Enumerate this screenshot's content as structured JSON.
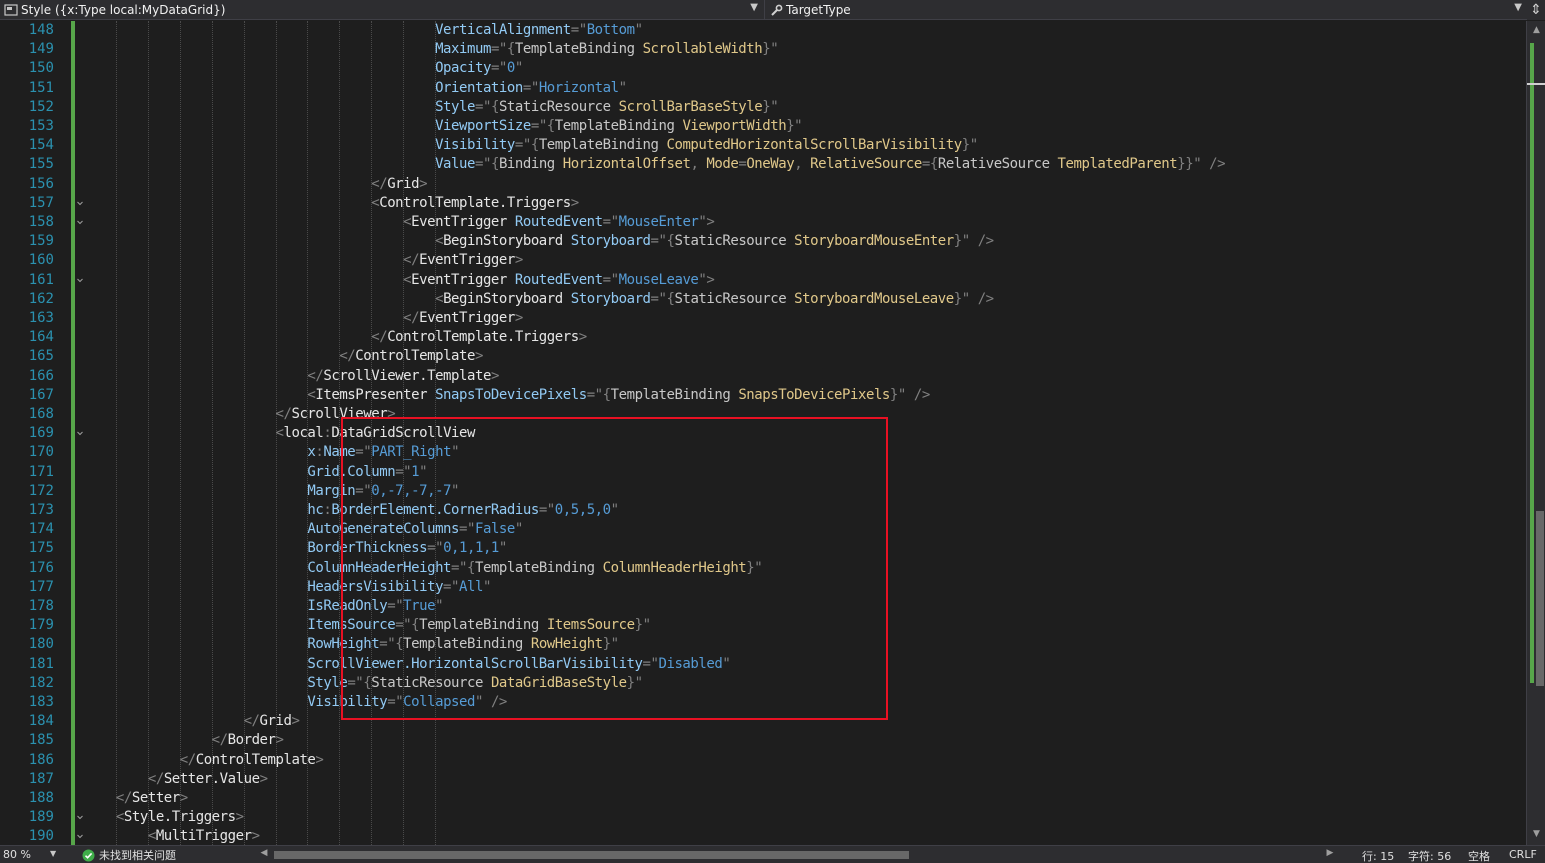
{
  "navbar": {
    "left_label": "Style ({x:Type local:MyDataGrid})",
    "left_icon": "class-member-icon",
    "right_label": "TargetType",
    "right_icon": "wrench-icon",
    "split_icon": "split-window-icon"
  },
  "editor": {
    "lines": [
      {
        "n": "148",
        "fold": false,
        "code": "                                            VerticalAlignment=\"Bottom\""
      },
      {
        "n": "149",
        "fold": false,
        "code": "                                            Maximum=\"{TemplateBinding ScrollableWidth}\""
      },
      {
        "n": "150",
        "fold": false,
        "code": "                                            Opacity=\"0\""
      },
      {
        "n": "151",
        "fold": false,
        "code": "                                            Orientation=\"Horizontal\""
      },
      {
        "n": "152",
        "fold": false,
        "code": "                                            Style=\"{StaticResource ScrollBarBaseStyle}\""
      },
      {
        "n": "153",
        "fold": false,
        "code": "                                            ViewportSize=\"{TemplateBinding ViewportWidth}\""
      },
      {
        "n": "154",
        "fold": false,
        "code": "                                            Visibility=\"{TemplateBinding ComputedHorizontalScrollBarVisibility}\""
      },
      {
        "n": "155",
        "fold": false,
        "code": "                                            Value=\"{Binding HorizontalOffset, Mode=OneWay, RelativeSource={RelativeSource TemplatedParent}}\" />"
      },
      {
        "n": "156",
        "fold": false,
        "code": "                                    </Grid>"
      },
      {
        "n": "157",
        "fold": true,
        "code": "                                    <ControlTemplate.Triggers>"
      },
      {
        "n": "158",
        "fold": true,
        "code": "                                        <EventTrigger RoutedEvent=\"MouseEnter\">"
      },
      {
        "n": "159",
        "fold": false,
        "code": "                                            <BeginStoryboard Storyboard=\"{StaticResource StoryboardMouseEnter}\" />"
      },
      {
        "n": "160",
        "fold": false,
        "code": "                                        </EventTrigger>"
      },
      {
        "n": "161",
        "fold": true,
        "code": "                                        <EventTrigger RoutedEvent=\"MouseLeave\">"
      },
      {
        "n": "162",
        "fold": false,
        "code": "                                            <BeginStoryboard Storyboard=\"{StaticResource StoryboardMouseLeave}\" />"
      },
      {
        "n": "163",
        "fold": false,
        "code": "                                        </EventTrigger>"
      },
      {
        "n": "164",
        "fold": false,
        "code": "                                    </ControlTemplate.Triggers>"
      },
      {
        "n": "165",
        "fold": false,
        "code": "                                </ControlTemplate>"
      },
      {
        "n": "166",
        "fold": false,
        "code": "                            </ScrollViewer.Template>"
      },
      {
        "n": "167",
        "fold": false,
        "code": "                            <ItemsPresenter SnapsToDevicePixels=\"{TemplateBinding SnapsToDevicePixels}\" />"
      },
      {
        "n": "168",
        "fold": false,
        "code": "                        </ScrollViewer>"
      },
      {
        "n": "169",
        "fold": true,
        "code": "                        <local:DataGridScrollView"
      },
      {
        "n": "170",
        "fold": false,
        "code": "                            x:Name=\"PART_Right\""
      },
      {
        "n": "171",
        "fold": false,
        "code": "                            Grid.Column=\"1\""
      },
      {
        "n": "172",
        "fold": false,
        "code": "                            Margin=\"0,-7,-7,-7\""
      },
      {
        "n": "173",
        "fold": false,
        "code": "                            hc:BorderElement.CornerRadius=\"0,5,5,0\""
      },
      {
        "n": "174",
        "fold": false,
        "code": "                            AutoGenerateColumns=\"False\""
      },
      {
        "n": "175",
        "fold": false,
        "code": "                            BorderThickness=\"0,1,1,1\""
      },
      {
        "n": "176",
        "fold": false,
        "code": "                            ColumnHeaderHeight=\"{TemplateBinding ColumnHeaderHeight}\""
      },
      {
        "n": "177",
        "fold": false,
        "code": "                            HeadersVisibility=\"All\""
      },
      {
        "n": "178",
        "fold": false,
        "code": "                            IsReadOnly=\"True\""
      },
      {
        "n": "179",
        "fold": false,
        "code": "                            ItemsSource=\"{TemplateBinding ItemsSource}\""
      },
      {
        "n": "180",
        "fold": false,
        "code": "                            RowHeight=\"{TemplateBinding RowHeight}\""
      },
      {
        "n": "181",
        "fold": false,
        "code": "                            ScrollViewer.HorizontalScrollBarVisibility=\"Disabled\""
      },
      {
        "n": "182",
        "fold": false,
        "code": "                            Style=\"{StaticResource DataGridBaseStyle}\""
      },
      {
        "n": "183",
        "fold": false,
        "code": "                            Visibility=\"Collapsed\" />"
      },
      {
        "n": "184",
        "fold": false,
        "code": "                    </Grid>"
      },
      {
        "n": "185",
        "fold": false,
        "code": "                </Border>"
      },
      {
        "n": "186",
        "fold": false,
        "code": "            </ControlTemplate>"
      },
      {
        "n": "187",
        "fold": false,
        "code": "        </Setter.Value>"
      },
      {
        "n": "188",
        "fold": false,
        "code": "    </Setter>"
      },
      {
        "n": "189",
        "fold": true,
        "code": "    <Style.Triggers>"
      },
      {
        "n": "190",
        "fold": true,
        "code": "        <MultiTrigger>"
      }
    ]
  },
  "statusbar": {
    "zoom": "80 %",
    "issues": "未找到相关问题",
    "line": "行: 15",
    "char": "字符: 56",
    "whitespace": "空格",
    "eol": "CRLF"
  },
  "colors": {
    "background": "#1e1e1e",
    "line_number": "#2b91af",
    "element": "#e6e6e6",
    "attribute": "#92caf4",
    "value": "#569cd6",
    "markup_extension": "#c8c8c8",
    "delimiter": "#808080",
    "change_bar": "#57a64a",
    "highlight_box": "#e81123"
  }
}
